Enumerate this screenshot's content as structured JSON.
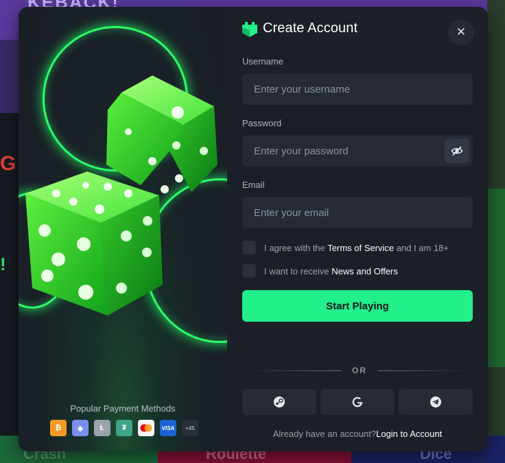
{
  "background": {
    "top_text": "KEBACK!",
    "left_letter": "G",
    "left_mark": "!",
    "tabs": [
      "Crash",
      "Roulette",
      "Dice"
    ]
  },
  "modal": {
    "title": "Create Account",
    "close_icon": "close-icon",
    "username": {
      "label": "Username",
      "placeholder": "Enter your username",
      "value": ""
    },
    "password": {
      "label": "Password",
      "placeholder": "Enter your password",
      "value": ""
    },
    "email": {
      "label": "Email",
      "placeholder": "Enter your email",
      "value": ""
    },
    "terms": {
      "prefix": "I agree with the ",
      "link": "Terms of Service",
      "suffix": " and I am 18+",
      "checked": false
    },
    "news": {
      "prefix": "I want to receive ",
      "link": "News and Offers",
      "checked": false
    },
    "submit_label": "Start Playing",
    "divider_label": "OR",
    "social": [
      {
        "name": "steam",
        "icon": "steam-icon"
      },
      {
        "name": "google",
        "icon": "google-icon"
      },
      {
        "name": "telegram",
        "icon": "telegram-icon"
      }
    ],
    "login_prompt": "Already have an account?",
    "login_link": "Login to Account"
  },
  "promo": {
    "payments_title": "Popular Payment Methods",
    "payment_methods": [
      {
        "name": "Bitcoin",
        "glyph": "₿"
      },
      {
        "name": "Ethereum",
        "glyph": "◆"
      },
      {
        "name": "Litecoin",
        "glyph": "Ł"
      },
      {
        "name": "Tether",
        "glyph": "₮"
      },
      {
        "name": "Mastercard",
        "glyph": ""
      },
      {
        "name": "Visa",
        "glyph": "VISA"
      },
      {
        "name": "More",
        "glyph": "+45"
      }
    ]
  },
  "colors": {
    "accent": "#22f08a",
    "modal_bg": "#1b1f27",
    "field_bg": "#252a33",
    "ring": "#2dff6a"
  }
}
